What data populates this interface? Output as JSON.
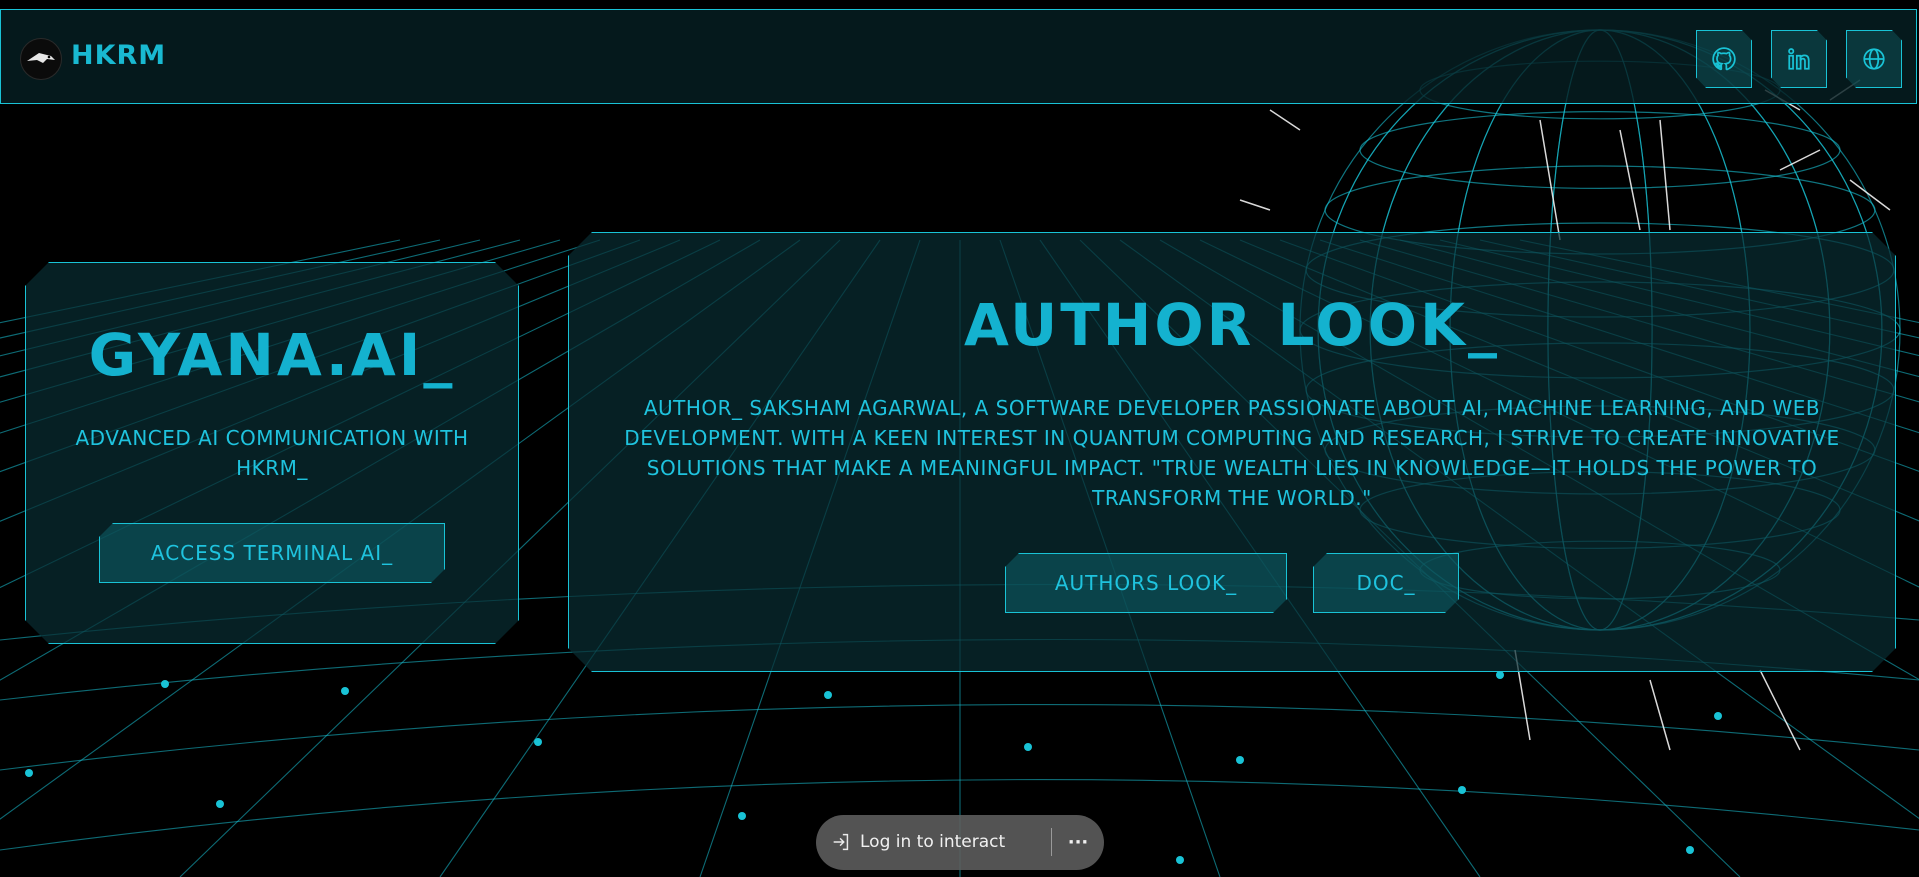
{
  "header": {
    "brand": "HKRM",
    "social": [
      {
        "icon": "github-icon"
      },
      {
        "icon": "linkedin-icon"
      },
      {
        "icon": "globe-icon"
      }
    ]
  },
  "left_panel": {
    "title": "GYANA.AI_",
    "subtitle": "ADVANCED AI COMMUNICATION WITH HKRM_",
    "button": "ACCESS TERMINAL AI_"
  },
  "right_panel": {
    "title": "AUTHOR LOOK_",
    "body": "AUTHOR_ SAKSHAM AGARWAL, A SOFTWARE DEVELOPER PASSIONATE ABOUT AI, MACHINE LEARNING, AND WEB DEVELOPMENT. WITH A KEEN INTEREST IN QUANTUM COMPUTING AND RESEARCH, I STRIVE TO CREATE INNOVATIVE SOLUTIONS THAT MAKE A MEANINGFUL IMPACT. \"TRUE WEALTH LIES IN KNOWLEDGE—IT HOLDS THE POWER TO TRANSFORM THE WORLD.\"",
    "buttons": [
      "AUTHORS LOOK_",
      "DOC_"
    ]
  },
  "overlay": {
    "login_label": "Log in to interact",
    "more_label": "···"
  },
  "colors": {
    "accent": "#19c3d6",
    "text": "#1fc3de",
    "background": "#000000"
  }
}
